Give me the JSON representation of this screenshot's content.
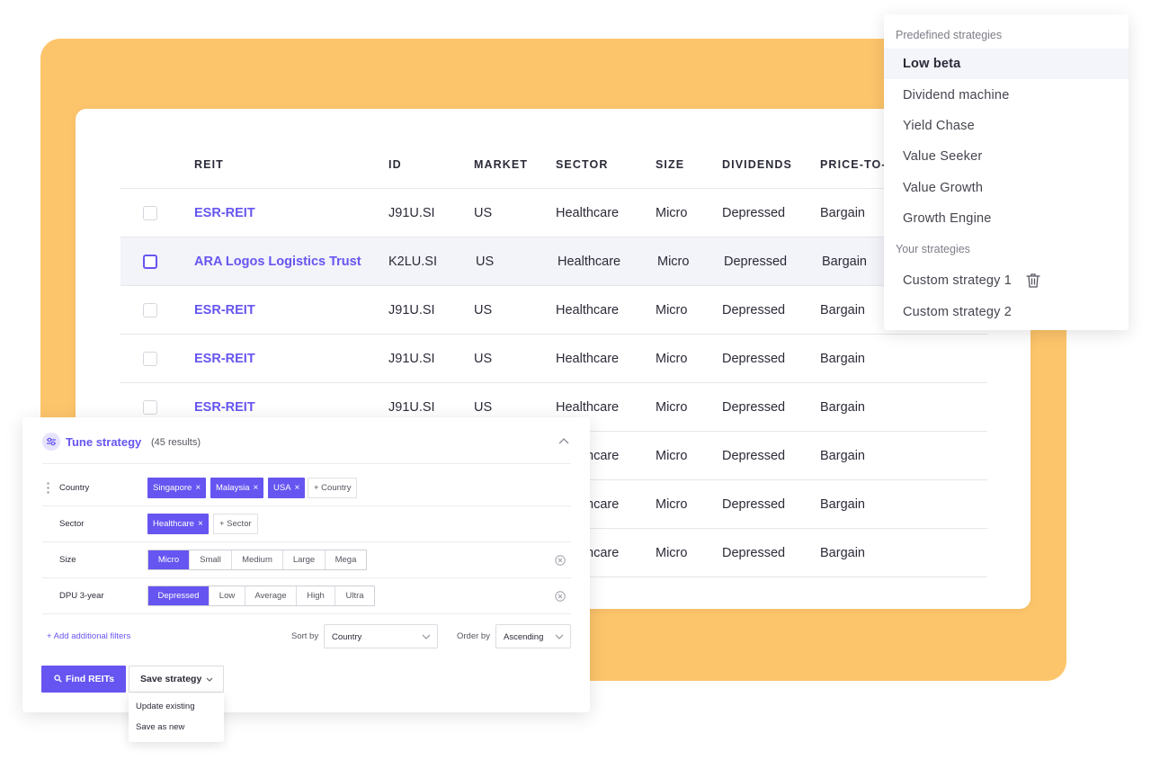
{
  "table": {
    "columns": [
      "REIT",
      "ID",
      "MARKET",
      "SECTOR",
      "SIZE",
      "DIVIDENDS",
      "PRICE-TO-"
    ],
    "rows": [
      {
        "name": "ESR-REIT",
        "id": "J91U.SI",
        "market": "US",
        "sector": "Healthcare",
        "size": "Micro",
        "dividends": "Depressed",
        "price": "Bargain"
      },
      {
        "name": "ARA Logos Logistics Trust",
        "id": "K2LU.SI",
        "market": "US",
        "sector": "Healthcare",
        "size": "Micro",
        "dividends": "Depressed",
        "price": "Bargain"
      },
      {
        "name": "ESR-REIT",
        "id": "J91U.SI",
        "market": "US",
        "sector": "Healthcare",
        "size": "Micro",
        "dividends": "Depressed",
        "price": "Bargain"
      },
      {
        "name": "ESR-REIT",
        "id": "J91U.SI",
        "market": "US",
        "sector": "Healthcare",
        "size": "Micro",
        "dividends": "Depressed",
        "price": "Bargain"
      },
      {
        "name": "ESR-REIT",
        "id": "J91U.SI",
        "market": "US",
        "sector": "Healthcare",
        "size": "Micro",
        "dividends": "Depressed",
        "price": "Bargain"
      },
      {
        "name": "",
        "id": "",
        "market": "",
        "sector": "hcare",
        "size": "Micro",
        "dividends": "Depressed",
        "price": "Bargain"
      },
      {
        "name": "",
        "id": "",
        "market": "",
        "sector": "hcare",
        "size": "Micro",
        "dividends": "Depressed",
        "price": "Bargain"
      },
      {
        "name": "",
        "id": "",
        "market": "",
        "sector": "hcare",
        "size": "Micro",
        "dividends": "Depressed",
        "price": "Bargain"
      }
    ]
  },
  "strategies": {
    "predefined_label": "Predefined strategies",
    "predefined": [
      "Low beta",
      "Dividend machine",
      "Yield Chase",
      "Value Seeker",
      "Value Growth",
      "Growth Engine"
    ],
    "yours_label": "Your strategies",
    "yours": [
      "Custom strategy 1",
      "Custom strategy 2"
    ]
  },
  "tune": {
    "title": "Tune strategy",
    "count": "(45 results)",
    "country_label": "Country",
    "country_chips": [
      "Singapore",
      "Malaysia",
      "USA"
    ],
    "country_add": "+ Country",
    "sector_label": "Sector",
    "sector_chips": [
      "Healthcare"
    ],
    "sector_add": "+ Sector",
    "size_label": "Size",
    "size_options": [
      "Micro",
      "Small",
      "Medium",
      "Large",
      "Mega"
    ],
    "dpu_label": "DPU 3-year",
    "dpu_options": [
      "Depressed",
      "Low",
      "Average",
      "High",
      "Ultra"
    ],
    "add_filters": "+ Add additional filters",
    "sort_label": "Sort by",
    "sort_value": "Country",
    "order_label": "Order by",
    "order_value": "Ascending",
    "find_button": "Find REITs",
    "save_button": "Save strategy",
    "save_menu": [
      "Update existing",
      "Save as new"
    ],
    "chip_remove": "×"
  },
  "colors": {
    "accent": "#6655f0",
    "orange": "#fdc56b"
  }
}
